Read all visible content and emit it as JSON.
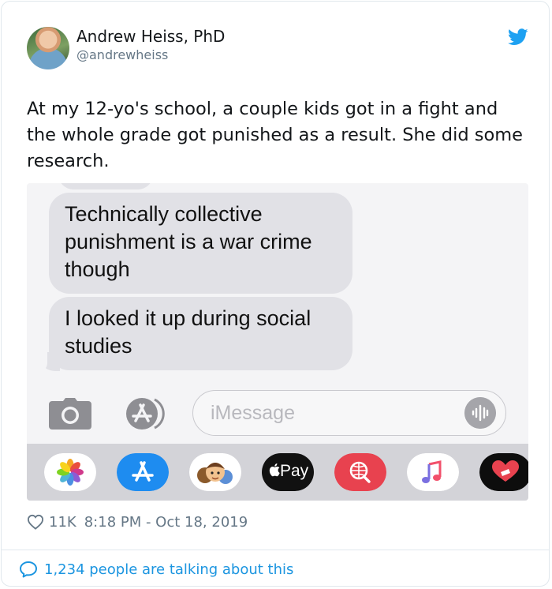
{
  "author": {
    "name": "Andrew Heiss, PhD",
    "handle": "@andrewheiss"
  },
  "tweet": {
    "text": "At my 12-yo's school, a couple kids got in a fight and the whole grade got punished as a result. She did some research."
  },
  "screenshot": {
    "messages": [
      "Technically collective punishment is a war crime though",
      "I looked it up during social studies"
    ],
    "input_placeholder": "iMessage",
    "apple_pay_label": "Pay",
    "app_drawer_icons": [
      "photos-icon",
      "app-store-icon",
      "memoji-icon",
      "apple-pay-icon",
      "search-globe-icon",
      "music-icon",
      "heart-sticker-icon"
    ]
  },
  "meta": {
    "likes": "11K",
    "timestamp": "8:18 PM - Oct 18, 2019"
  },
  "conversation": {
    "label": "1,234 people are talking about this"
  },
  "colors": {
    "twitter_blue": "#1da1f2",
    "link_blue": "#1b95e0",
    "secondary_text": "#657786",
    "bubble_gray": "#e1e1e6"
  }
}
